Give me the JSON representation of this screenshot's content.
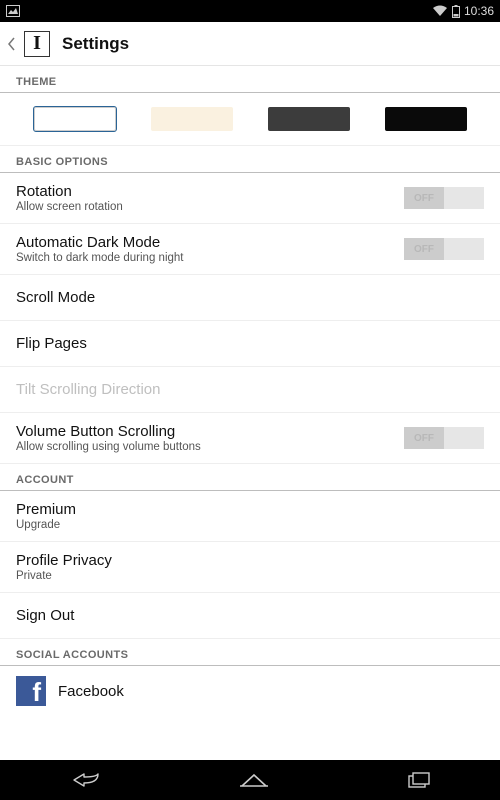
{
  "status": {
    "time": "10:36"
  },
  "actionbar": {
    "title": "Settings",
    "logo_letter": "I"
  },
  "sections": {
    "theme": {
      "header": "THEME"
    },
    "basic": {
      "header": "BASIC OPTIONS",
      "rotation": {
        "title": "Rotation",
        "sub": "Allow screen rotation",
        "toggle": "OFF"
      },
      "darkmode": {
        "title": "Automatic Dark Mode",
        "sub": "Switch to dark mode during night",
        "toggle": "OFF"
      },
      "scrollmode": {
        "title": "Scroll Mode"
      },
      "flippages": {
        "title": "Flip Pages"
      },
      "tilt": {
        "title": "Tilt Scrolling Direction"
      },
      "volscroll": {
        "title": "Volume Button Scrolling",
        "sub": "Allow scrolling using volume buttons",
        "toggle": "OFF"
      }
    },
    "account": {
      "header": "ACCOUNT",
      "premium": {
        "title": "Premium",
        "sub": "Upgrade"
      },
      "privacy": {
        "title": "Profile Privacy",
        "sub": "Private"
      },
      "signout": {
        "title": "Sign Out"
      }
    },
    "social": {
      "header": "SOCIAL ACCOUNTS",
      "facebook": {
        "label": "Facebook"
      }
    }
  },
  "theme_colors": {
    "c1": "#ffffff",
    "c2": "#faf1e0",
    "c3": "#3c3c3c",
    "c4": "#0a0a0a"
  }
}
